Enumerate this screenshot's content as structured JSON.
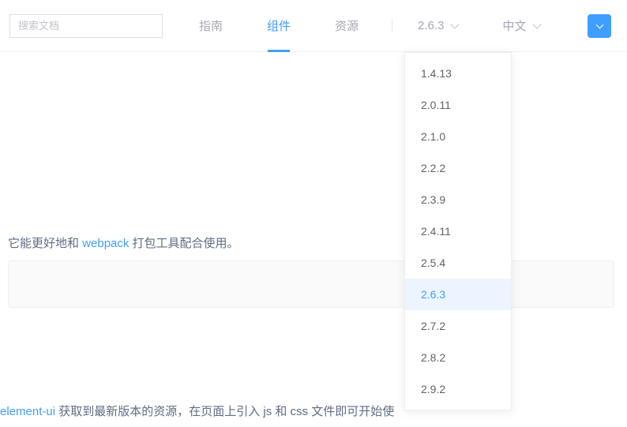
{
  "search": {
    "placeholder": "搜索文档"
  },
  "nav": {
    "guide": "指南",
    "component": "组件",
    "resource": "资源"
  },
  "version": {
    "current": "2.6.3",
    "options": [
      "1.4.13",
      "2.0.11",
      "2.1.0",
      "2.2.2",
      "2.3.9",
      "2.4.11",
      "2.5.4",
      "2.6.3",
      "2.7.2",
      "2.8.2",
      "2.9.2"
    ]
  },
  "language": {
    "current": "中文"
  },
  "content": {
    "para1_before": "它能更好地和 ",
    "para1_link": "webpack",
    "para1_after": " 打包工具配合使用。",
    "para2_link": "element-ui",
    "para2_after": " 获取到最新版本的资源，在页面上引入 js 和 css 文件即可开始使"
  }
}
